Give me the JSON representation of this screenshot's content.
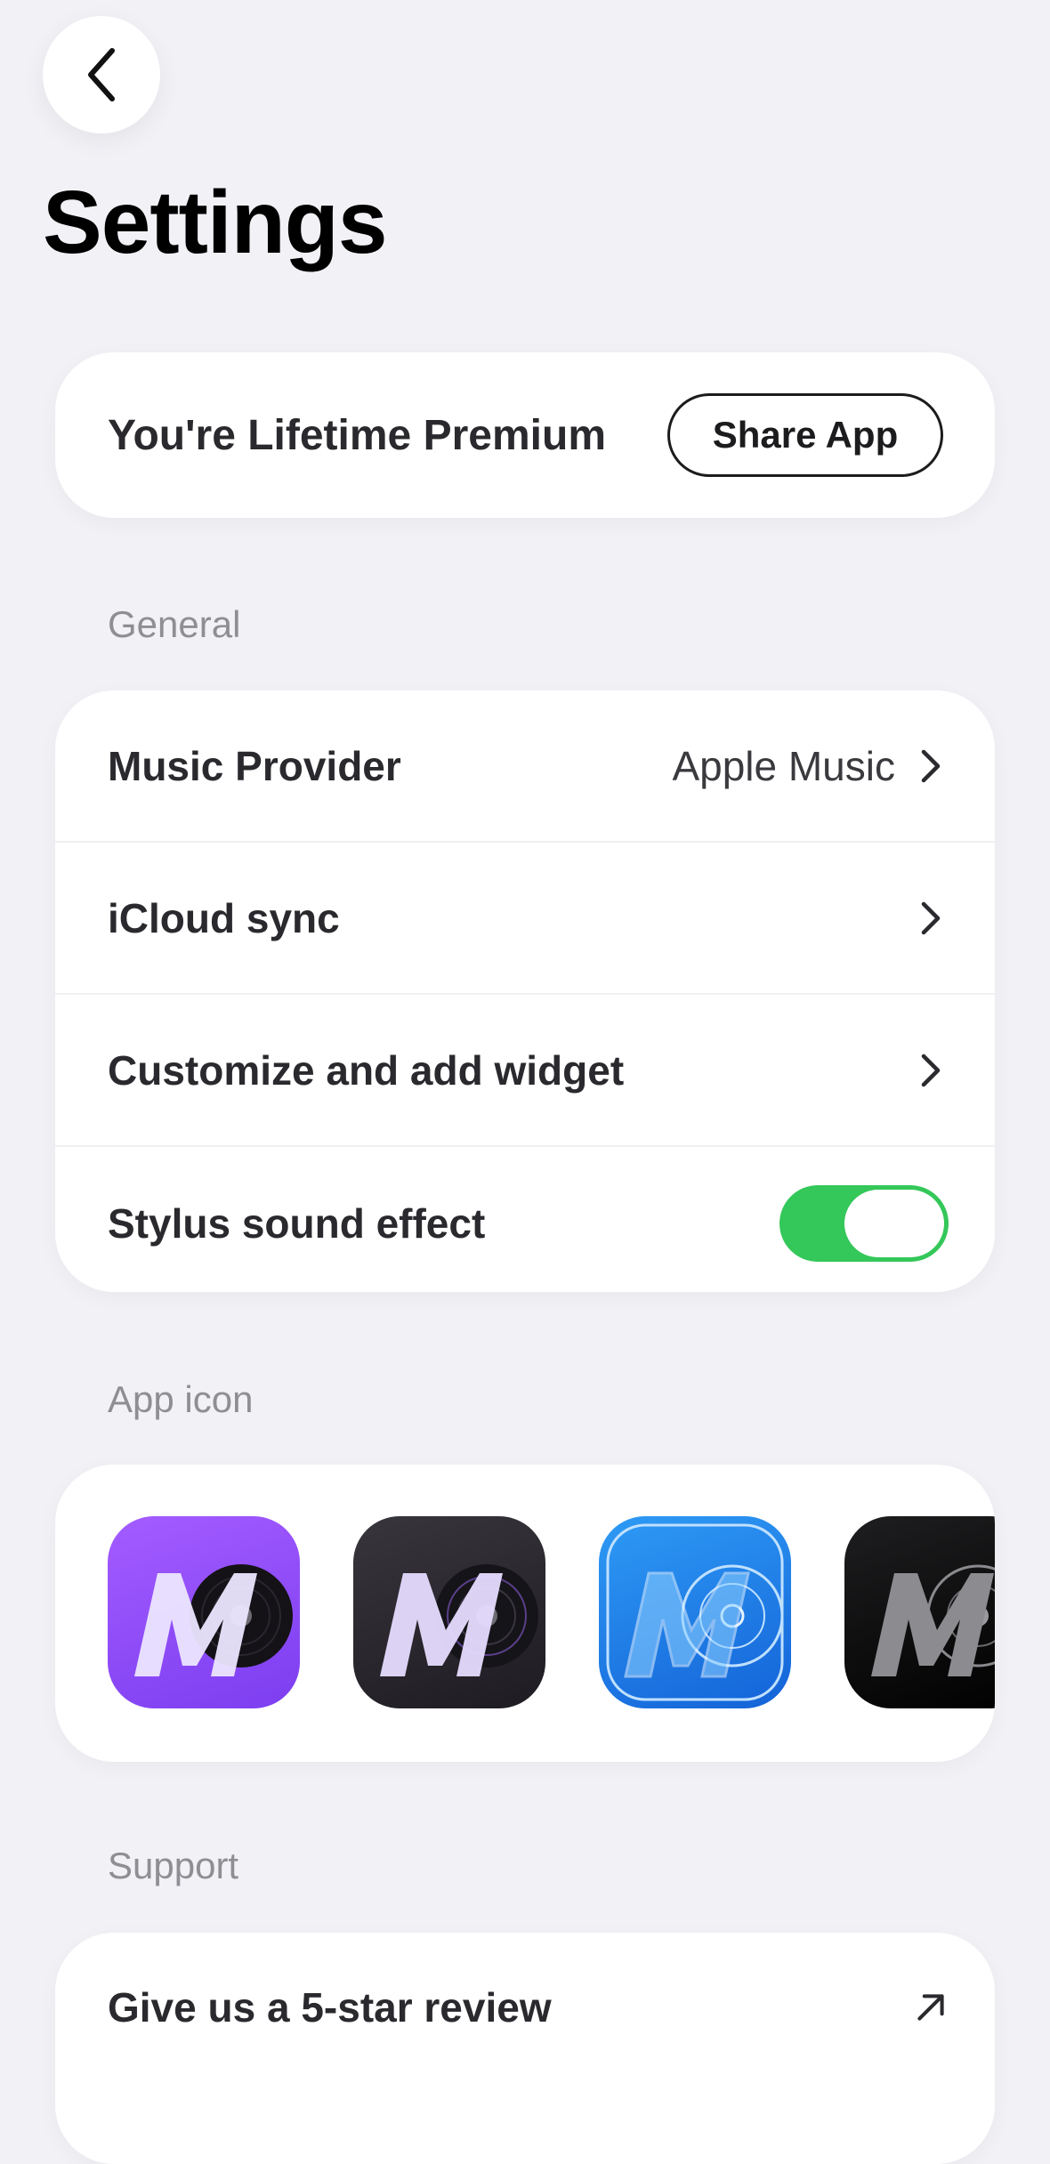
{
  "header": {
    "title": "Settings"
  },
  "premium": {
    "status_text": "You're Lifetime Premium",
    "share_label": "Share App"
  },
  "general": {
    "section_label": "General",
    "items": [
      {
        "label": "Music Provider",
        "value": "Apple Music"
      },
      {
        "label": "iCloud sync",
        "value": ""
      },
      {
        "label": "Customize and add widget",
        "value": ""
      },
      {
        "label": "Stylus sound effect",
        "value": ""
      }
    ],
    "stylus_sound_enabled": true
  },
  "app_icon": {
    "section_label": "App icon",
    "icons": [
      {
        "name": "purple-vinyl-icon",
        "bg": "#8a4df5"
      },
      {
        "name": "dark-vinyl-icon",
        "bg": "#2c2a30"
      },
      {
        "name": "blue-blueprint-icon",
        "bg": "#1f7ee8"
      },
      {
        "name": "black-chrome-icon",
        "bg": "#0a0a0a"
      }
    ]
  },
  "support": {
    "section_label": "Support",
    "items": [
      {
        "label": "Give us a 5-star review"
      }
    ]
  },
  "colors": {
    "background": "#f2f1f6",
    "toggle_on": "#34c759",
    "card": "#ffffff"
  }
}
